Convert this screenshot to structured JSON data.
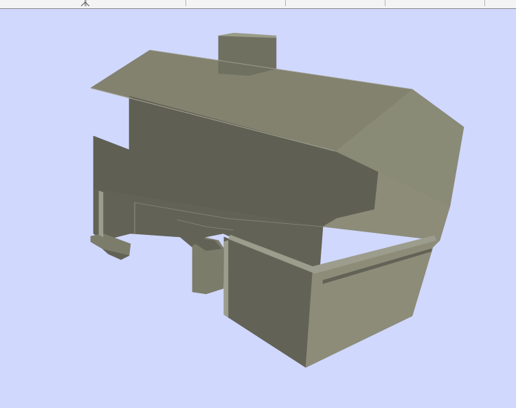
{
  "window": {
    "strip_segments": 6
  },
  "viewport": {
    "background_color": "#d0d8fd",
    "model": {
      "subject": "house",
      "palette": {
        "roof_front": "#82826f",
        "roof_right": "#8e8f7b",
        "gable_right": "#8a8b77",
        "upper_wall": "#5f5f53",
        "lower_wall": "#626256",
        "porch_wall": "#7c7c6b",
        "right_wall": "#8c8c79",
        "chimney_front": "#707061",
        "chimney_top": "#9a9b87",
        "edge": "#9c9d8c"
      }
    }
  }
}
